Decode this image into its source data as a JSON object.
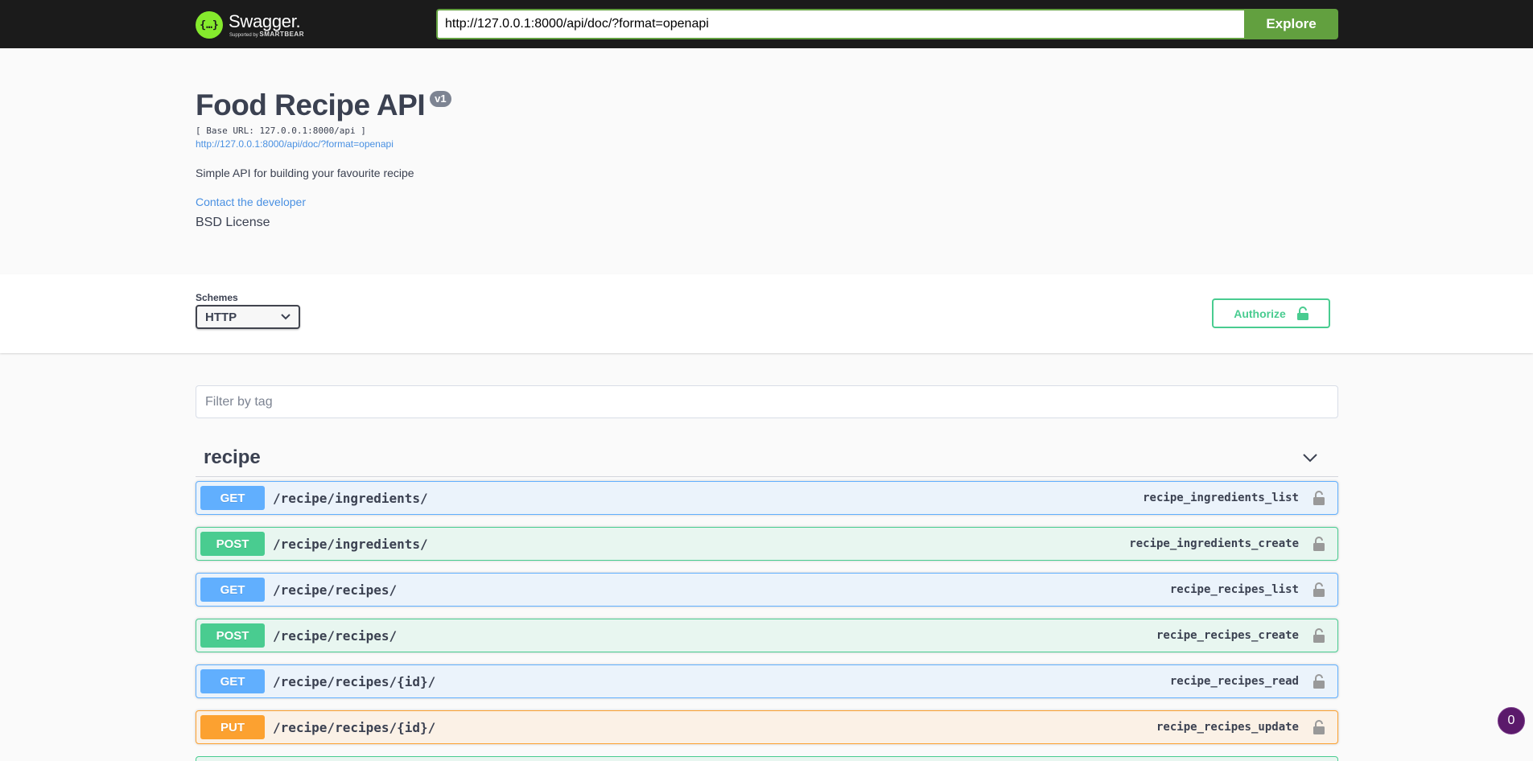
{
  "topbar": {
    "logo_name": "Swagger.",
    "logo_sub_prefix": "Supported by",
    "logo_sub_brand": "SMARTBEAR",
    "url_value": "http://127.0.0.1:8000/api/doc/?format=openapi",
    "explore_label": "Explore"
  },
  "info": {
    "title": "Food Recipe API",
    "version": "v1",
    "base_url": "[ Base URL: 127.0.0.1:8000/api ]",
    "spec_link": "http://127.0.0.1:8000/api/doc/?format=openapi",
    "description": "Simple API for building your favourite recipe",
    "contact": "Contact the developer",
    "license": "BSD License"
  },
  "schemes": {
    "label": "Schemes",
    "selected": "HTTP",
    "authorize_label": "Authorize"
  },
  "filter": {
    "placeholder": "Filter by tag"
  },
  "tag": {
    "name": "recipe"
  },
  "operations": [
    {
      "method": "GET",
      "path": "/recipe/ingredients/",
      "operation_id": "recipe_ingredients_list"
    },
    {
      "method": "POST",
      "path": "/recipe/ingredients/",
      "operation_id": "recipe_ingredients_create"
    },
    {
      "method": "GET",
      "path": "/recipe/recipes/",
      "operation_id": "recipe_recipes_list"
    },
    {
      "method": "POST",
      "path": "/recipe/recipes/",
      "operation_id": "recipe_recipes_create"
    },
    {
      "method": "GET",
      "path": "/recipe/recipes/{id}/",
      "operation_id": "recipe_recipes_read"
    },
    {
      "method": "PUT",
      "path": "/recipe/recipes/{id}/",
      "operation_id": "recipe_recipes_update"
    }
  ],
  "float_badge": {
    "count": "0"
  },
  "colors": {
    "get": "#61affe",
    "post": "#49cc90",
    "put": "#fca130",
    "explore": "#62a03f",
    "logo": "#85ea2d"
  }
}
